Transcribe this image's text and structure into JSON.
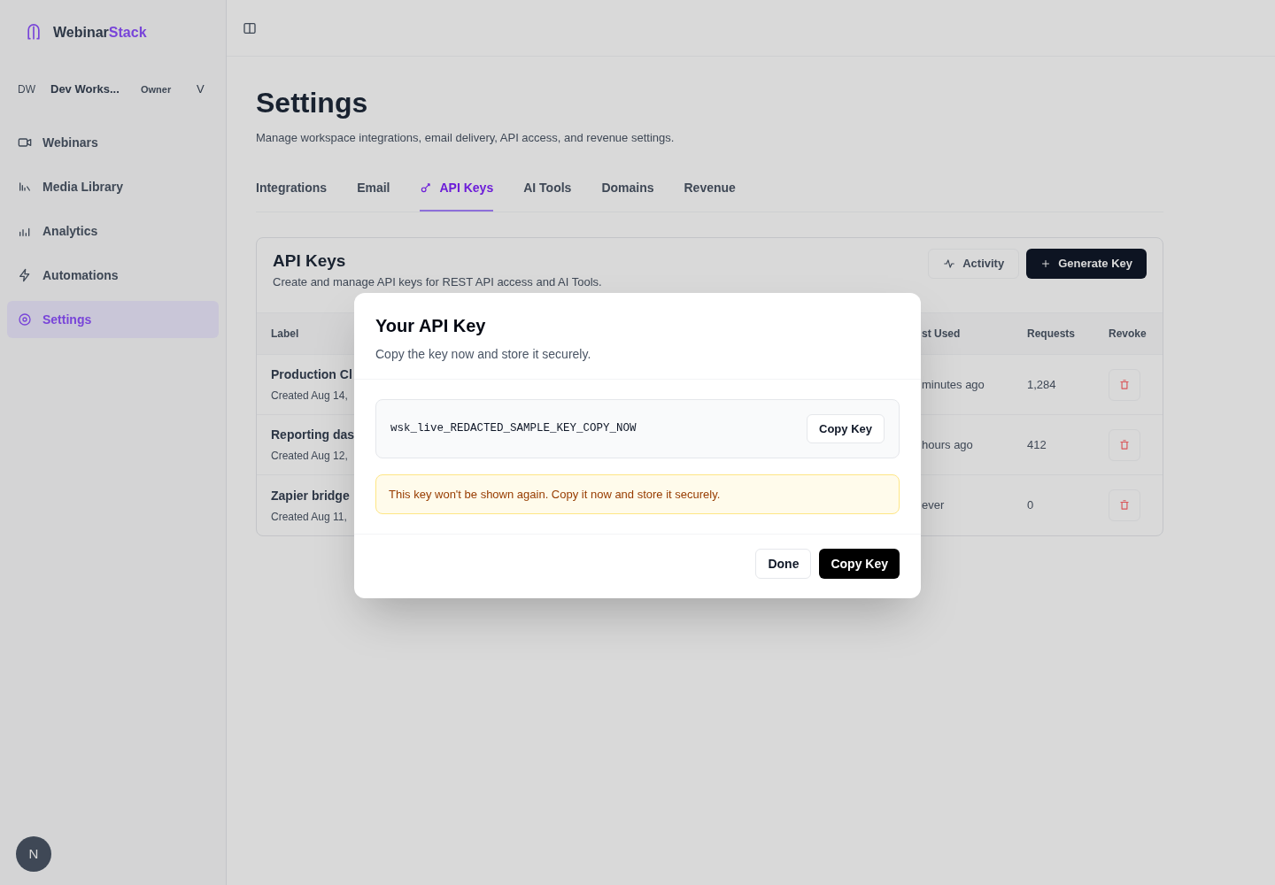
{
  "sidebar": {
    "brand": {
      "part_1": "Webinar",
      "part_2": "Stack"
    },
    "workspace": {
      "initials": "DW",
      "name": "Dev Works...",
      "role": "Owner",
      "caret": "V"
    },
    "items": [
      {
        "label": "Webinars",
        "selected": false
      },
      {
        "label": "Media Library",
        "selected": false
      },
      {
        "label": "Analytics",
        "selected": false
      },
      {
        "label": "Automations",
        "selected": false
      },
      {
        "label": "Settings",
        "selected": true
      }
    ],
    "avatar": "N"
  },
  "page": {
    "title": "Settings",
    "subtitle": "Manage workspace integrations, email delivery, API access, and revenue settings.",
    "tabs": [
      {
        "label": "Integrations",
        "selected": false
      },
      {
        "label": "Email",
        "selected": false
      },
      {
        "label": "API Keys",
        "selected": true
      },
      {
        "label": "AI Tools",
        "selected": false
      },
      {
        "label": "Domains",
        "selected": false
      },
      {
        "label": "Revenue",
        "selected": false
      }
    ],
    "card": {
      "title": "API Keys",
      "subtitle": "Create and manage API keys for REST API access and AI Tools.",
      "buttons": [
        {
          "label": "Activity",
          "kind": "secondary"
        },
        {
          "label": "Generate Key",
          "kind": "primary"
        }
      ],
      "columns": [
        "Label",
        "st Used",
        "Requests",
        "Revoke"
      ],
      "rows": [
        {
          "label": "Production Cl",
          "created": "Created Aug 14,",
          "last_used": "minutes ago",
          "requests": "1,284"
        },
        {
          "label": "Reporting das",
          "created": "Created Aug 12,",
          "last_used": "hours ago",
          "requests": "412"
        },
        {
          "label": "Zapier bridge",
          "created": "Created Aug 11,",
          "last_used": "ever",
          "requests": "0"
        }
      ]
    }
  },
  "modal": {
    "title": "Your API Key",
    "subtitle": "Copy the key now and store it securely.",
    "key": "wsk_live_REDACTED_SAMPLE_KEY_COPY_NOW",
    "inline_button": "Copy Key",
    "warning": "This key won't be shown again. Copy it now and store it securely.",
    "buttons": [
      {
        "label": "Done",
        "kind": "secondary"
      },
      {
        "label": "Copy Key",
        "kind": "primary"
      }
    ]
  }
}
